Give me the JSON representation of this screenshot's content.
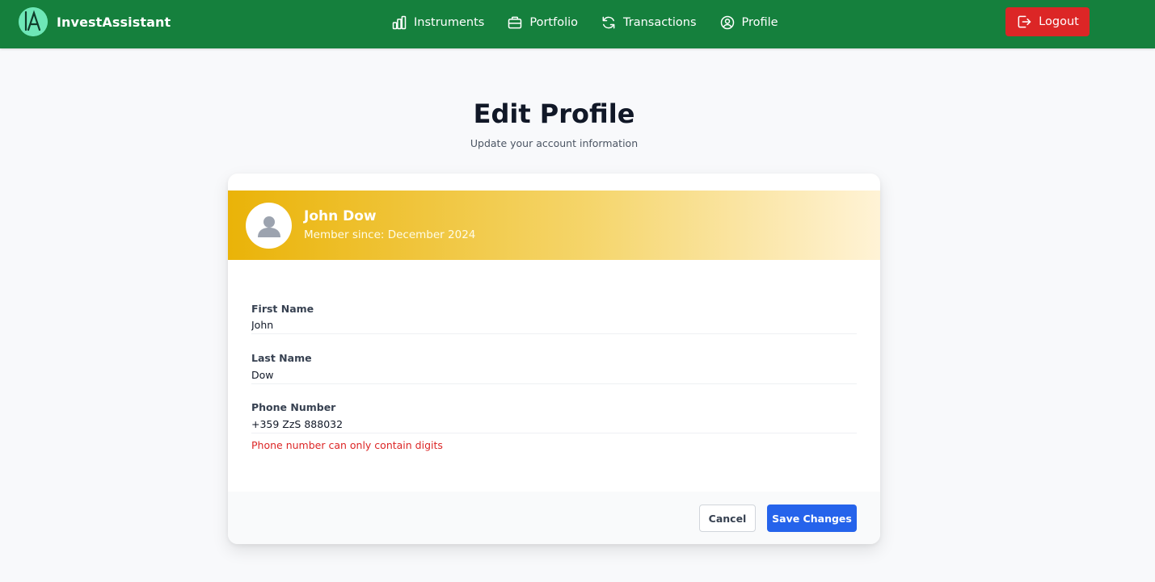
{
  "app": {
    "name": "InvestAssistant",
    "logo_icon": "invest-assistant-logo-icon",
    "colors": {
      "navbar": "#15803d",
      "logout": "#dc2626",
      "primary": "#2563eb",
      "error": "#dc2626",
      "banner_start": "#eab308"
    }
  },
  "nav": {
    "items": [
      {
        "label": "Instruments",
        "icon": "bar-chart-icon"
      },
      {
        "label": "Portfolio",
        "icon": "briefcase-icon"
      },
      {
        "label": "Transactions",
        "icon": "refresh-icon"
      },
      {
        "label": "Profile",
        "icon": "user-circle-icon"
      }
    ],
    "logout": {
      "label": "Logout",
      "icon": "logout-icon"
    }
  },
  "page": {
    "title": "Edit Profile",
    "subtitle": "Update your account information"
  },
  "profile": {
    "name": "John Dow",
    "member_since": "Member since: December 2024",
    "avatar_icon": "user-avatar-icon"
  },
  "form": {
    "first_name": {
      "label": "First Name",
      "value": "John"
    },
    "last_name": {
      "label": "Last Name",
      "value": "Dow"
    },
    "phone": {
      "label": "Phone Number",
      "value": "+359 ZzS 888032",
      "error": "Phone number can only contain digits"
    }
  },
  "actions": {
    "cancel": "Cancel",
    "save": "Save Changes"
  }
}
